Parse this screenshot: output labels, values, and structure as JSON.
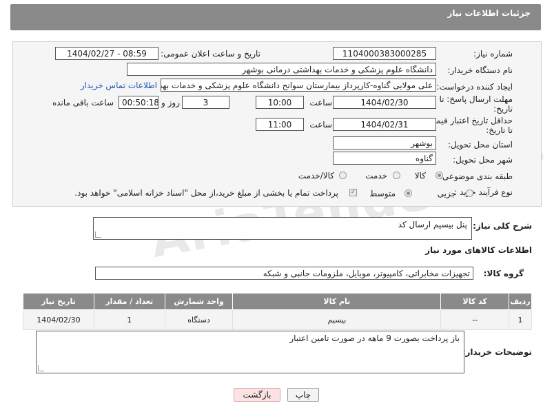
{
  "header": {
    "title": "جزئیات اطلاعات نیاز"
  },
  "form": {
    "need_number": {
      "label": "شماره نیاز:",
      "value": "1104000383000285"
    },
    "announce": {
      "label": "تاریخ و ساعت اعلان عمومی:",
      "value": "1404/02/27 - 08:59"
    },
    "buyer": {
      "label": "نام دستگاه خریدار:",
      "value": "دانشگاه علوم پزشکی و خدمات بهداشتی درمانی بوشهر"
    },
    "requester": {
      "label": "ایجاد کننده درخواست:",
      "value": "علی مولایی گناوه-کارپرداز بیمارستان سوانح دانشگاه علوم پزشکی و خدمات بهد",
      "contact_link": "اطلاعات تماس خریدار"
    },
    "deadline": {
      "label_line1": "مهلت ارسال پاسخ: تا",
      "label_line2": "تاریخ:",
      "date": "1404/02/30",
      "time_label": "ساعت",
      "time": "10:00",
      "days": "3",
      "days_label": "روز و",
      "remaining": "00:50:18",
      "remaining_label": "ساعت باقی مانده"
    },
    "price_validity": {
      "label_line1": "حداقل تاریخ اعتبار قیمت:",
      "label_line2": "تا تاریخ:",
      "date": "1404/02/31",
      "time_label": "ساعت",
      "time": "11:00"
    },
    "province": {
      "label": "استان محل تحویل:",
      "value": "بوشهر"
    },
    "city": {
      "label": "شهر محل تحویل:",
      "value": "گناوه"
    },
    "category": {
      "label": "طبقه بندی موضوعی:",
      "options": [
        "کالا",
        "خدمت",
        "کالا/خدمت"
      ],
      "selected": "کالا"
    },
    "process": {
      "label": "نوع فرآیند خرید :",
      "options": [
        "جزیی",
        "متوسط"
      ],
      "selected": "متوسط",
      "payment_note": "پرداخت تمام یا بخشی از مبلغ خرید،از محل \"اسناد خزانه اسلامی\" خواهد بود."
    }
  },
  "description": {
    "label": "شرح کلی نیاز:",
    "value": "پنل بیسیم ارسال کد"
  },
  "goods_section": {
    "title": "اطلاعات کالاهای مورد نیاز",
    "group_label": "گروه کالا:",
    "group_value": "تجهیزات مخابراتی، کامپیوتر، موبایل، ملزومات جانبی و شبکه"
  },
  "table": {
    "headers": [
      "ردیف",
      "کد کالا",
      "نام کالا",
      "واحد شمارش",
      "تعداد / مقدار",
      "تاریخ نیاز"
    ],
    "rows": [
      [
        "1",
        "--",
        "بیسیم",
        "دستگاه",
        "1",
        "1404/02/30"
      ]
    ]
  },
  "buyer_notes": {
    "label": "توضیحات خریدار:",
    "value": "باز پرداخت بصورت 9 ماهه در صورت تامین اعتبار"
  },
  "buttons": {
    "print": "چاپ",
    "back": "بازگشت"
  }
}
